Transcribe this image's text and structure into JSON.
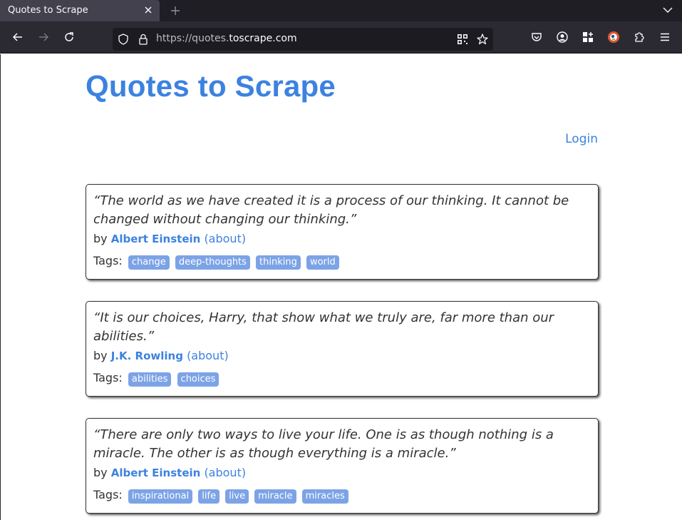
{
  "browser": {
    "tab_title": "Quotes to Scrape",
    "url_prefix": "https://quotes.",
    "url_host": "toscrape.com"
  },
  "page": {
    "title": "Quotes to Scrape",
    "login_label": "Login"
  },
  "quotes": [
    {
      "text": "“The world as we have created it is a process of our thinking. It cannot be changed without changing our thinking.”",
      "by": "by",
      "author": "Albert Einstein",
      "about": "(about)",
      "tags_label": "Tags:",
      "tags": [
        "change",
        "deep-thoughts",
        "thinking",
        "world"
      ]
    },
    {
      "text": "“It is our choices, Harry, that show what we truly are, far more than our abilities.”",
      "by": "by",
      "author": "J.K. Rowling",
      "about": "(about)",
      "tags_label": "Tags:",
      "tags": [
        "abilities",
        "choices"
      ]
    },
    {
      "text": "“There are only two ways to live your life. One is as though nothing is a miracle. The other is as though everything is a miracle.”",
      "by": "by",
      "author": "Albert Einstein",
      "about": "(about)",
      "tags_label": "Tags:",
      "tags": [
        "inspirational",
        "life",
        "live",
        "miracle",
        "miracles"
      ]
    }
  ],
  "colors": {
    "accent": "#3c82e0",
    "tag_bg": "#7ca3e6",
    "chrome_dark": "#2b2a33"
  },
  "icons": [
    "close-icon",
    "plus-icon",
    "chevron-down-icon",
    "back-icon",
    "forward-icon",
    "reload-icon",
    "shield-icon",
    "lock-icon",
    "qr-code-icon",
    "star-icon",
    "pocket-icon",
    "account-icon",
    "extensions-grid-icon",
    "duckduckgo-icon",
    "puzzle-icon",
    "menu-icon"
  ]
}
